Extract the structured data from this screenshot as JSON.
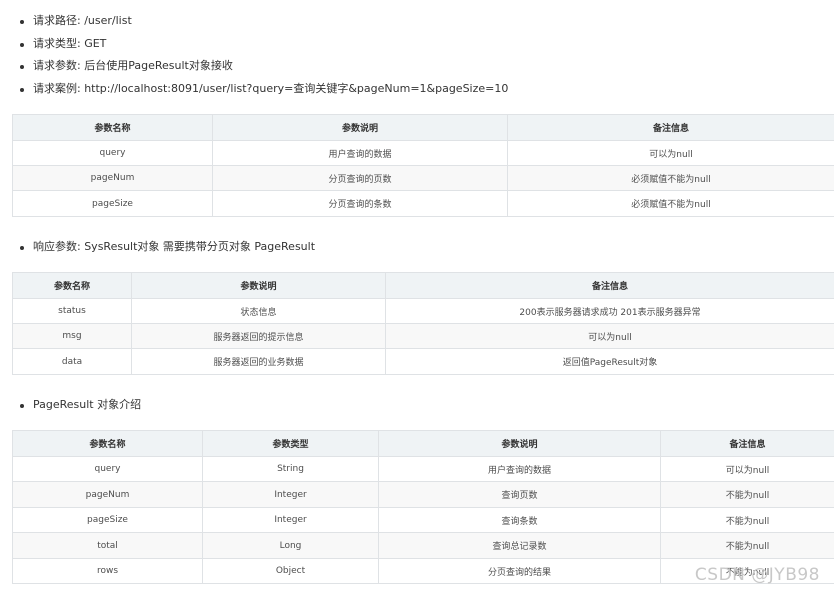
{
  "request_bullets": [
    "请求路径: /user/list",
    "请求类型: GET",
    "请求参数: 后台使用PageResult对象接收",
    "请求案例: http://localhost:8091/user/list?query=查询关键字&pageNum=1&pageSize=10"
  ],
  "table1": {
    "headers": [
      "参数名称",
      "参数说明",
      "备注信息"
    ],
    "rows": [
      [
        "query",
        "用户查询的数据",
        "可以为null"
      ],
      [
        "pageNum",
        "分页查询的页数",
        "必须赋值不能为null"
      ],
      [
        "pageSize",
        "分页查询的条数",
        "必须赋值不能为null"
      ]
    ]
  },
  "response_bullet": "响应参数: SysResult对象 需要携带分页对象 PageResult",
  "table2": {
    "headers": [
      "参数名称",
      "参数说明",
      "备注信息"
    ],
    "rows": [
      [
        "status",
        "状态信息",
        "200表示服务器请求成功 201表示服务器异常"
      ],
      [
        "msg",
        "服务器返回的提示信息",
        "可以为null"
      ],
      [
        "data",
        "服务器返回的业务数据",
        "返回值PageResult对象"
      ]
    ]
  },
  "pageresult_bullet": "PageResult 对象介绍",
  "table3": {
    "headers": [
      "参数名称",
      "参数类型",
      "参数说明",
      "备注信息"
    ],
    "rows": [
      [
        "query",
        "String",
        "用户查询的数据",
        "可以为null"
      ],
      [
        "pageNum",
        "Integer",
        "查询页数",
        "不能为null"
      ],
      [
        "pageSize",
        "Integer",
        "查询条数",
        "不能为null"
      ],
      [
        "total",
        "Long",
        "查询总记录数",
        "不能为null"
      ],
      [
        "rows",
        "Object",
        "分页查询的结果",
        "不能为null"
      ]
    ]
  },
  "watermark": "CSDN @JYB98"
}
